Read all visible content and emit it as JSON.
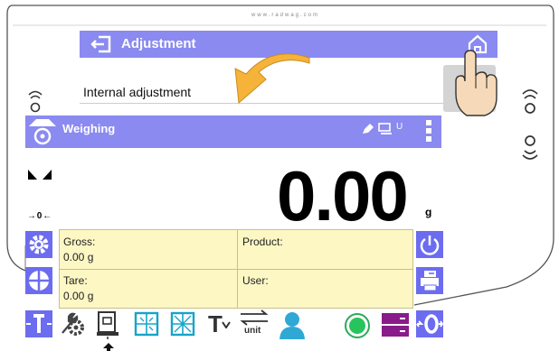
{
  "url_text": "www.radwag.com",
  "adjustment_header": {
    "title": "Adjustment"
  },
  "adjustment_menu": {
    "item": "Internal adjustment"
  },
  "weighing_header": {
    "title": "Weighing",
    "unit_indicator": "U"
  },
  "weight": {
    "value": "0.00",
    "unit": "g"
  },
  "zero_indicator": "→ 0 ←",
  "info_fields": {
    "gross_label": "Gross:",
    "gross_value": "0.00 g",
    "product_label": "Product:",
    "tare_label": "Tare:",
    "tare_value": "0.00 g",
    "user_label": "User:"
  },
  "bottom_icons": {
    "tare_label": "T",
    "zero_label": "0",
    "unit_label": "unit",
    "tare_value_label": "T"
  },
  "colors": {
    "header": "#8a8af0",
    "button": "#6c6cf0",
    "info_bg": "#fdf7c4",
    "arrow": "#f5b33a"
  }
}
